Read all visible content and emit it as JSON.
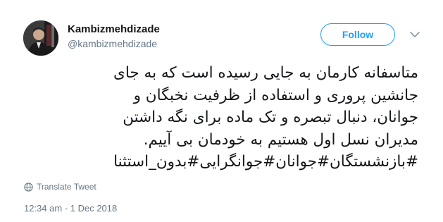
{
  "author": {
    "display_name": "Kambizmehdizade",
    "username": "@kambizmehdizade",
    "avatar_icon": "profile-photo"
  },
  "follow_button": {
    "label": "Follow",
    "color": "#1da1f2"
  },
  "more_menu": {
    "icon": "chevron-down-icon"
  },
  "tweet": {
    "lines": [
      "متاسفانه کارمان به جایی رسیده است که به جای",
      "جانشین پروری و استفاده از ظرفیت نخبگان و",
      "جوانان، دنبال تبصره و تک ماده برای نگه داشتن",
      "مدیران نسل اول هستیم به خودمان بی آییم.",
      "#بازنشستگان#جوانان#جوانگرایی#بدون_استثنا"
    ]
  },
  "translate": {
    "label": "Translate Tweet",
    "icon": "globe-icon"
  },
  "timestamp": "12:34 am - 1 Dec 2018",
  "colors": {
    "text": "#14171a",
    "secondary": "#657786",
    "accent": "#1da1f2"
  }
}
